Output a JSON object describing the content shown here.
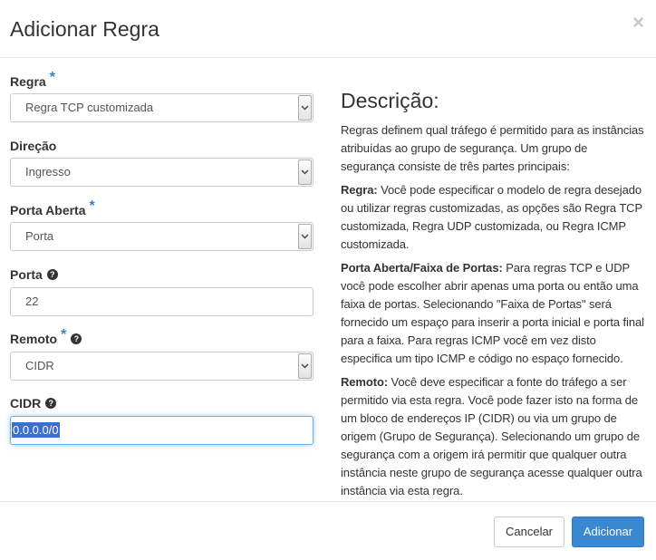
{
  "header": {
    "title": "Adicionar Regra",
    "close_glyph": "×"
  },
  "form": {
    "required_mark": "*",
    "regra": {
      "label": "Regra",
      "value": "Regra TCP customizada"
    },
    "direcao": {
      "label": "Direção",
      "value": "Ingresso"
    },
    "porta_aberta": {
      "label": "Porta Aberta",
      "value": "Porta"
    },
    "porta": {
      "label": "Porta",
      "value": "22"
    },
    "remoto": {
      "label": "Remoto",
      "value": "CIDR"
    },
    "cidr": {
      "label": "CIDR",
      "value": "0.0.0.0/0"
    }
  },
  "description": {
    "title": "Descrição:",
    "intro": "Regras definem qual tráfego é permitido para as instâncias atribuídas ao grupo de segurança. Um grupo de segurança consiste de três partes principais:",
    "regra_term": "Regra:",
    "regra_text": " Você pode especificar o modelo de regra desejado ou utilizar regras customizadas, as opções são Regra TCP customizada, Regra UDP customizada, ou Regra ICMP customizada.",
    "porta_term": "Porta Aberta/Faixa de Portas:",
    "porta_text": " Para regras TCP e UDP você pode escolher abrir apenas uma porta ou então uma faixa de portas. Selecionando \"Faixa de Portas\" será fornecido um espaço para inserir a porta inicial e porta final para a faixa. Para regras ICMP você em vez disto especifica um tipo ICMP e código no espaço fornecido.",
    "remoto_term": "Remoto:",
    "remoto_text": " Você deve especificar a fonte do tráfego a ser permitido via esta regra. Você pode fazer isto na forma de um bloco de endereços IP (CIDR) ou via um grupo de origem (Grupo de Segurança). Selecionando um grupo de segurança com a origem irá permitir que qualquer outra instância neste grupo de segurança acesse qualquer outra instância via esta regra."
  },
  "footer": {
    "cancel_label": "Cancelar",
    "add_label": "Adicionar"
  },
  "colors": {
    "primary": "#3a88d2",
    "required": "#3b7fc4",
    "focus": "#66afe9"
  }
}
